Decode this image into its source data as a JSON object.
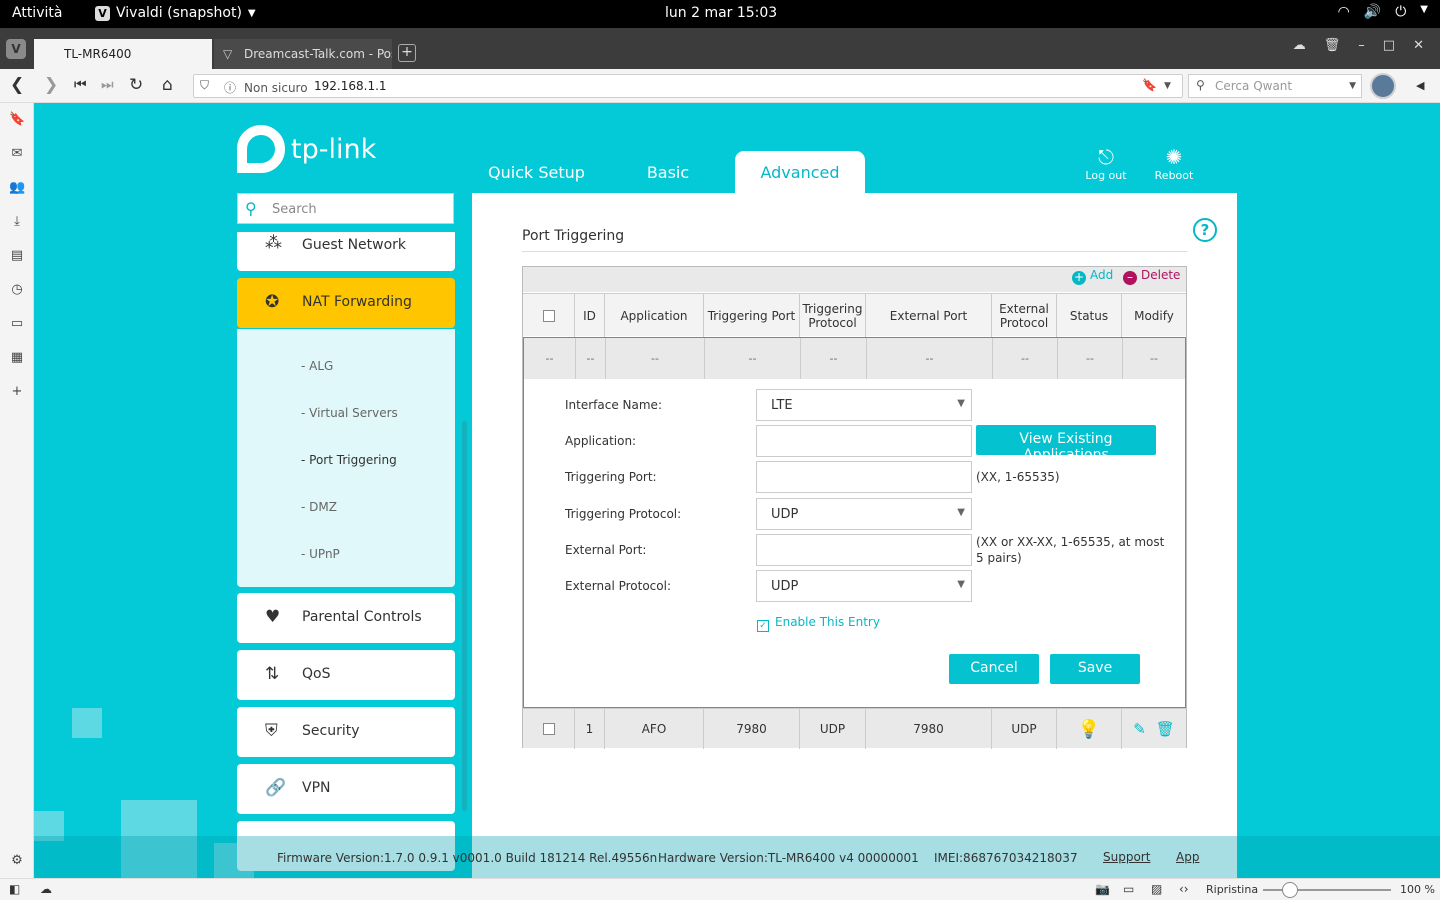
{
  "gnome": {
    "activities": "Attività",
    "app_name": "Vivaldi (snapshot)",
    "clock": "lun 2 mar  15:03"
  },
  "browser": {
    "tabs": [
      {
        "title": "TL-MR6400"
      },
      {
        "title": "Dreamcast-Talk.com - Post"
      }
    ],
    "security_label": "Non sicuro",
    "url": "192.168.1.1",
    "search_placeholder": "Cerca Qwant",
    "status": {
      "reset_label": "Ripristina",
      "zoom": "100 %"
    }
  },
  "router": {
    "brand": "tp-link",
    "nav": {
      "quick_setup": "Quick Setup",
      "basic": "Basic",
      "advanced": "Advanced"
    },
    "header_buttons": {
      "logout": "Log out",
      "reboot": "Reboot"
    },
    "search_placeholder": "Search",
    "menu": {
      "guest_network": "Guest Network",
      "nat_forwarding": "NAT Forwarding",
      "sub": [
        "- ALG",
        "- Virtual Servers",
        "- Port Triggering",
        "- DMZ",
        "- UPnP"
      ],
      "parental": "Parental Controls",
      "qos": "QoS",
      "security": "Security",
      "vpn": "VPN"
    },
    "page_title": "Port Triggering",
    "toolbar": {
      "add": "Add",
      "delete": "Delete"
    },
    "columns": [
      "ID",
      "Application",
      "Triggering Port",
      "Triggering Protocol",
      "External Port",
      "External Protocol",
      "Status",
      "Modify"
    ],
    "placeholder_row": [
      "--",
      "--",
      "--",
      "--",
      "--",
      "--",
      "--",
      "--",
      "--"
    ],
    "form": {
      "interface_label": "Interface Name:",
      "interface_value": "LTE",
      "application_label": "Application:",
      "application_value": "",
      "view_apps": "View Existing Applications",
      "trig_port_label": "Triggering Port:",
      "trig_port_hint": "(XX, 1-65535)",
      "trig_proto_label": "Triggering Protocol:",
      "trig_proto_value": "UDP",
      "ext_port_label": "External Port:",
      "ext_port_hint": "(XX or XX-XX, 1-65535, at most 5 pairs)",
      "ext_proto_label": "External Protocol:",
      "ext_proto_value": "UDP",
      "enable_label": "Enable This Entry",
      "enable_checked": true,
      "cancel": "Cancel",
      "save": "Save"
    },
    "rows": [
      {
        "id": "1",
        "application": "AFO",
        "trig_port": "7980",
        "trig_proto": "UDP",
        "ext_port": "7980",
        "ext_proto": "UDP"
      }
    ],
    "footer": {
      "firmware": "Firmware Version:1.7.0 0.9.1 v0001.0 Build 181214 Rel.49556n",
      "hardware": "Hardware Version:TL-MR6400 v4 00000001",
      "imei": "IMEI:868767034218037",
      "support": "Support",
      "app": "App"
    },
    "colors": {
      "accent": "#04c9d6",
      "selected": "#ffc600",
      "delete": "#b0125e"
    }
  }
}
